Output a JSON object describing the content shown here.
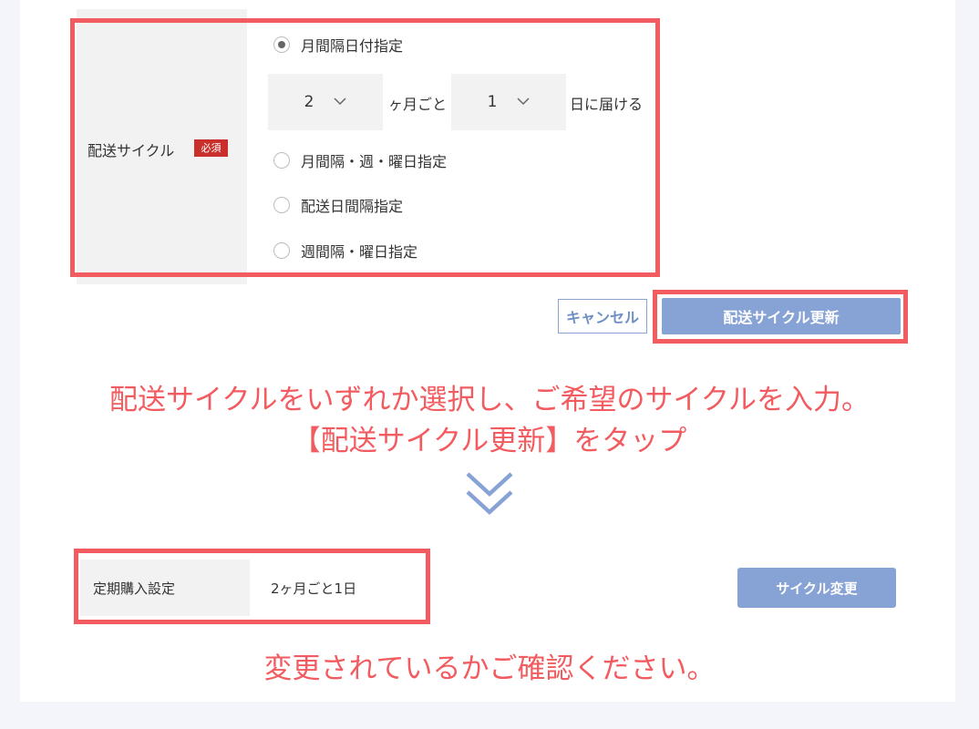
{
  "form": {
    "field_label": "配送サイクル",
    "required_badge": "必須",
    "options": [
      {
        "label": "月間隔日付指定",
        "selected": true
      },
      {
        "label": "月間隔・週・曜日指定",
        "selected": false
      },
      {
        "label": "配送日間隔指定",
        "selected": false
      },
      {
        "label": "週間隔・曜日指定",
        "selected": false
      }
    ],
    "month_select": "2",
    "month_suffix": "ヶ月ごと",
    "day_select": "1",
    "day_suffix": "日に届ける",
    "cancel_label": "キャンセル",
    "update_label": "配送サイクル更新"
  },
  "instructions": {
    "line1": "配送サイクルをいずれか選択し、ご希望のサイクルを入力。",
    "line2": "【配送サイクル更新】をタップ",
    "line3": "変更されているかご確認ください。"
  },
  "result": {
    "label": "定期購入設定",
    "value": "2ヶ月ごと1日",
    "change_label": "サイクル変更"
  },
  "colors": {
    "highlight": "#f25b5f",
    "button": "#87a2d4",
    "badge": "#c9302c"
  },
  "icons": {
    "select_chevron": "chevron-down-icon",
    "step_arrow": "double-chevron-down-icon"
  }
}
